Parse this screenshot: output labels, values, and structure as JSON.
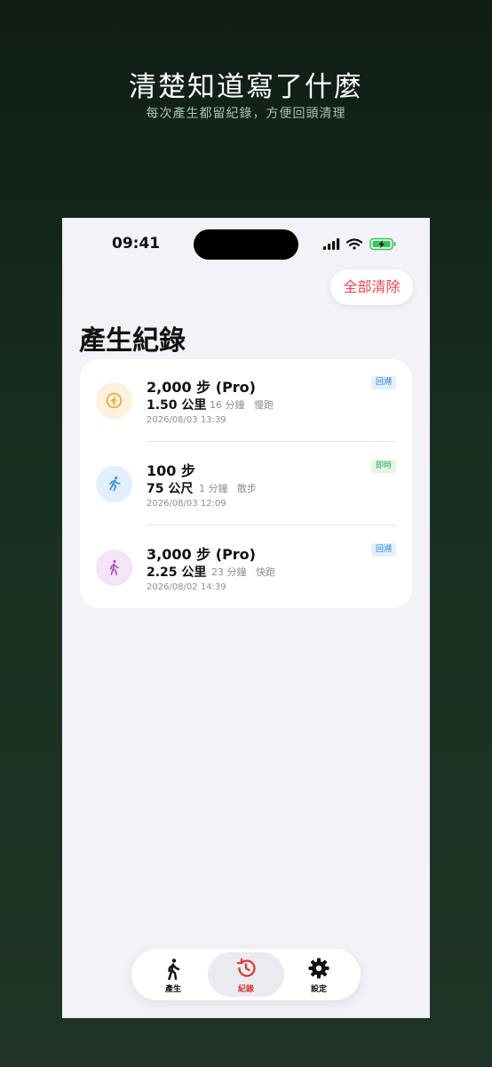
{
  "hero": {
    "title": "清楚知道寫了什麼",
    "subtitle": "每次產生都留紀錄，方便回頭清理"
  },
  "status_bar": {
    "time": "09:41"
  },
  "header": {
    "clear_all_label": "全部清除",
    "title": "產生紀錄"
  },
  "records": [
    {
      "steps": "2,000 步 (Pro)",
      "distance": "1.50 公里",
      "duration": "16 分鐘",
      "mode": "慢跑",
      "date": "2026/08/03 13:39",
      "badge": "回溯",
      "badge_color": "#2f80d8",
      "icon": "jogging-icon",
      "icon_color": "#e8a93a"
    },
    {
      "steps": "100 步",
      "distance": "75 公尺",
      "duration": "1 分鐘",
      "mode": "散步",
      "date": "2026/08/03 12:09",
      "badge": "即時",
      "badge_color": "#34a853",
      "icon": "running-icon",
      "icon_color": "#3d8fe0"
    },
    {
      "steps": "3,000 步 (Pro)",
      "distance": "2.25 公里",
      "duration": "23 分鐘",
      "mode": "快跑",
      "date": "2026/08/02 14:39",
      "badge": "回溯",
      "badge_color": "#2f80d8",
      "icon": "walking-icon",
      "icon_color": "#b34fc4"
    }
  ],
  "tab_bar": {
    "tabs": [
      {
        "label": "產生",
        "icon": "walking-icon",
        "active": false
      },
      {
        "label": "紀錄",
        "icon": "history-icon",
        "active": true
      },
      {
        "label": "設定",
        "icon": "gear-icon",
        "active": false
      }
    ]
  },
  "colors": {
    "accent_red": "#e5484d",
    "active_tab": "#d93a3a"
  }
}
